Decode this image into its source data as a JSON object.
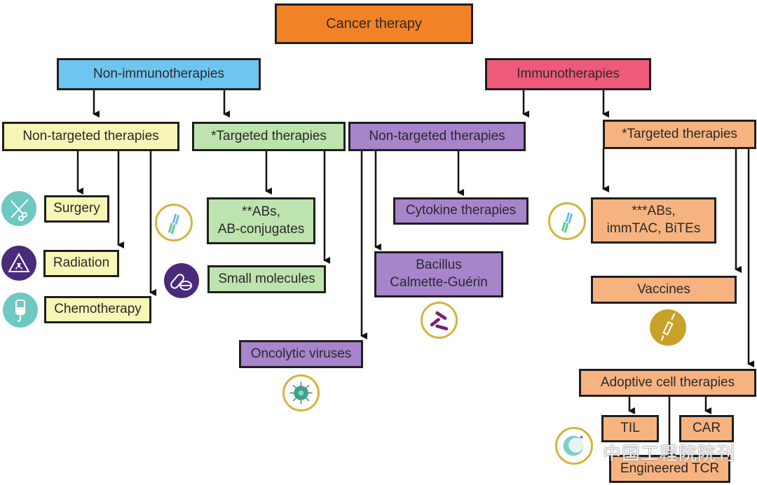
{
  "diagram": {
    "root": {
      "label": "Cancer therapy",
      "color": "#f28226"
    },
    "branches": {
      "non_immuno": {
        "label": "Non-immunotherapies",
        "color": "#6ec6f0",
        "non_targeted": {
          "label": "Non-targeted therapies",
          "color": "#f8f6b6",
          "items": [
            {
              "label": "Surgery",
              "icon": "scissors-icon"
            },
            {
              "label": "Radiation",
              "icon": "radiation-icon"
            },
            {
              "label": "Chemotherapy",
              "icon": "iv-bag-icon"
            }
          ]
        },
        "targeted": {
          "label": "*Targeted therapies",
          "color": "#bde4ae",
          "items": [
            {
              "label_line1": "**ABs,",
              "label_line2": "AB-conjugates",
              "icon": "antibody-icon"
            },
            {
              "label": "Small molecules",
              "icon": "pills-icon"
            }
          ]
        }
      },
      "immuno": {
        "label": "Immunotherapies",
        "color": "#f05a7a",
        "non_targeted": {
          "label": "Non-targeted therapies",
          "color": "#a884cc",
          "items": [
            {
              "label": "Cytokine therapies"
            },
            {
              "label_line1": "Bacillus",
              "label_line2": "Calmette-Guérin",
              "icon": "bacteria-icon"
            },
            {
              "label": "Oncolytic viruses",
              "icon": "virus-icon"
            }
          ]
        },
        "targeted": {
          "label": "*Targeted therapies",
          "color": "#f7b37f",
          "items": [
            {
              "label_line1": "***ABs,",
              "label_line2": "immTAC, BiTEs",
              "icon": "antibody-icon"
            },
            {
              "label": "Vaccines",
              "icon": "syringe-icon"
            },
            {
              "label": "Adoptive cell therapies",
              "icon": "t-cell-icon",
              "children": [
                {
                  "label": "TIL"
                },
                {
                  "label": "CAR"
                },
                {
                  "label": "Engineered TCR"
                }
              ]
            }
          ]
        }
      }
    }
  },
  "watermark": "中国工程院院刊"
}
